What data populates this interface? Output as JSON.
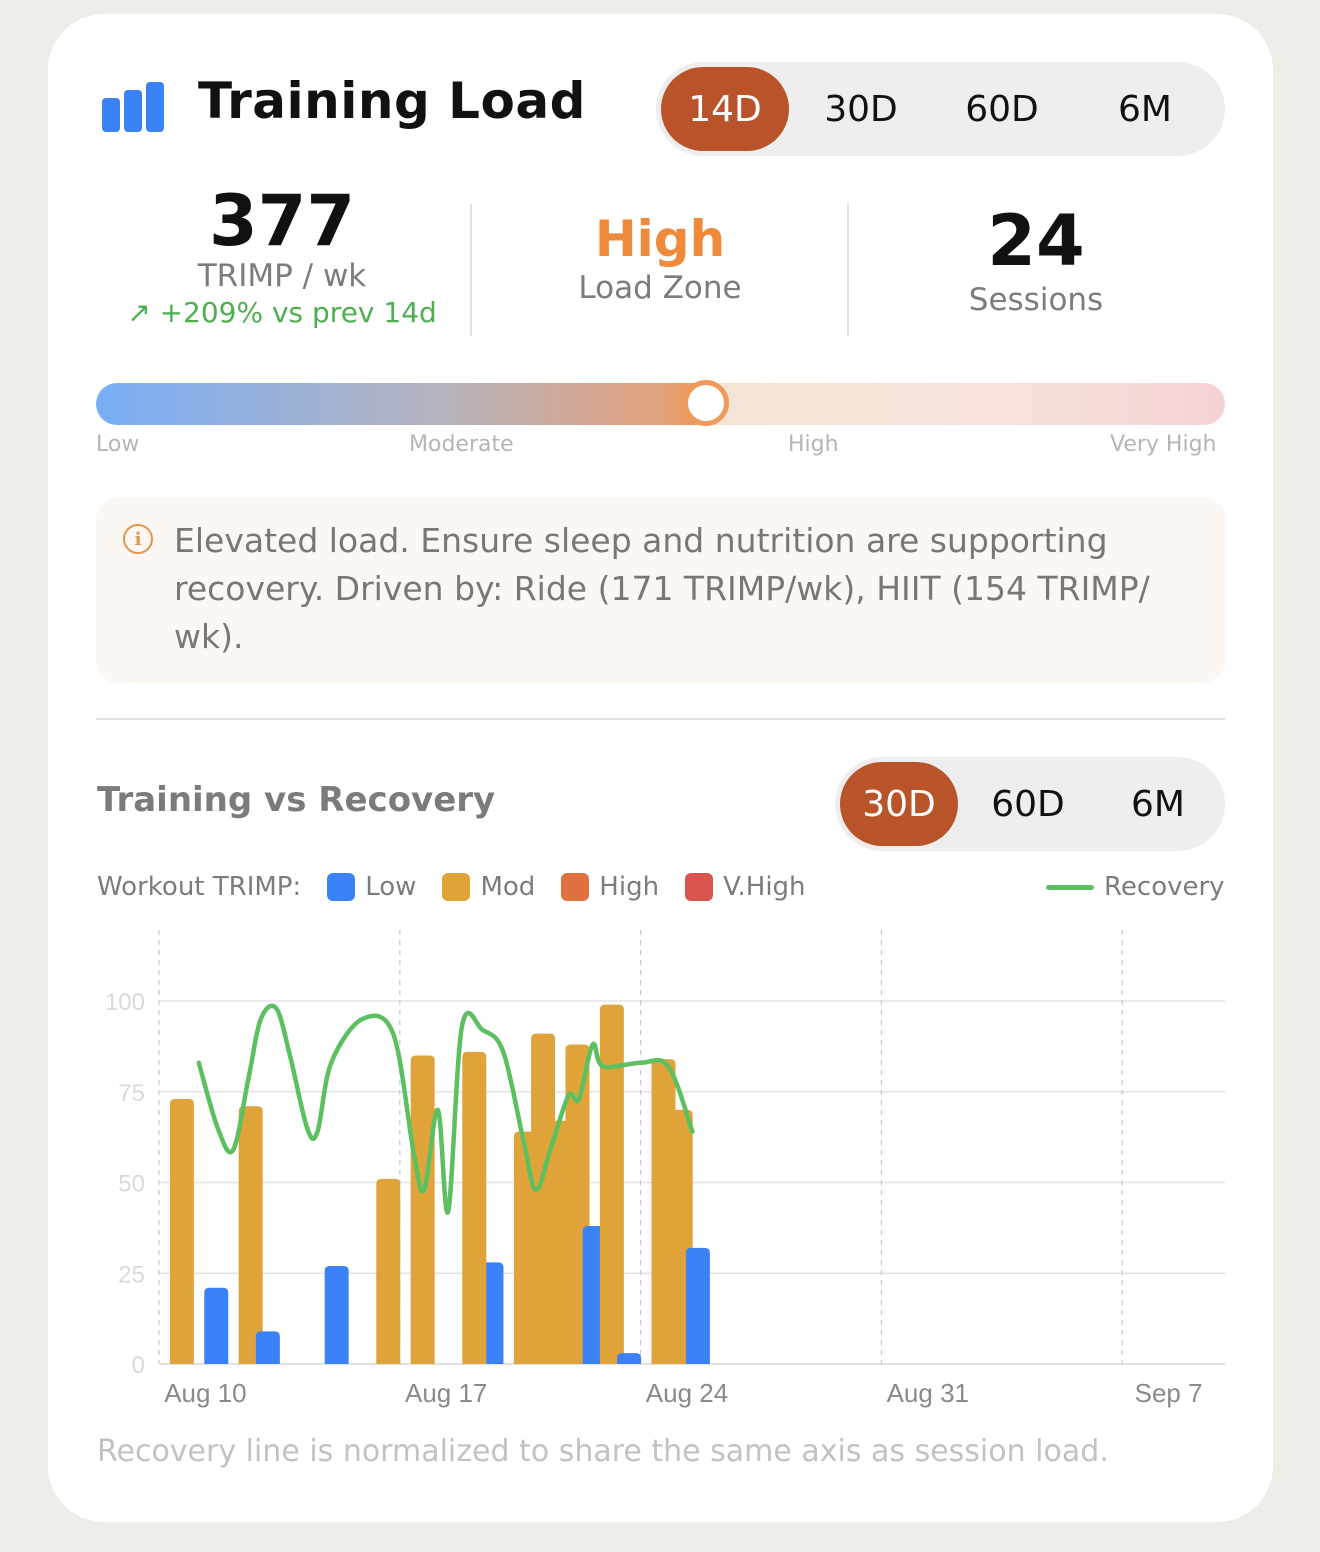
{
  "header": {
    "title": "Training Load",
    "range_options": [
      "14D",
      "30D",
      "60D",
      "6M"
    ],
    "selected_range": "14D"
  },
  "stats": {
    "trimp_value": "377",
    "trimp_label": "TRIMP / wk",
    "trimp_change_arrow": "↗",
    "trimp_change": "+209% vs prev 14d",
    "zone_value": "High",
    "zone_label": "Load Zone",
    "sessions_value": "24",
    "sessions_label": "Sessions"
  },
  "gauge": {
    "level_fraction": 0.54,
    "labels": [
      "Low",
      "Moderate",
      "High",
      "Very High"
    ]
  },
  "alert": {
    "icon": "info-icon",
    "text": "Elevated load. Ensure sleep and nutrition are supporting recovery. Driven by: Ride (171 TRIMP/wk), HIIT (154 TRIMP/ wk)."
  },
  "section": {
    "title": "Training vs Recovery",
    "range_options": [
      "30D",
      "60D",
      "6M"
    ],
    "selected_range": "30D"
  },
  "legend": {
    "prefix": "Workout TRIMP:",
    "items": [
      {
        "label": "Low",
        "color": "#3b82f6"
      },
      {
        "label": "Mod",
        "color": "#e0a33a"
      },
      {
        "label": "High",
        "color": "#e07040"
      },
      {
        "label": "V.High",
        "color": "#d9534f"
      }
    ],
    "recovery_label": "Recovery",
    "recovery_color": "#5cbf60"
  },
  "footnote": "Recovery line is normalized to share the same axis as session load.",
  "chart_data": {
    "type": "bar",
    "x_labels": [
      "Aug 10",
      "Aug 17",
      "Aug 24",
      "Aug 31",
      "Sep 7"
    ],
    "x_label_days": [
      1,
      8,
      15,
      22,
      29
    ],
    "ylim": [
      0,
      120
    ],
    "yticks": [
      0,
      25,
      50,
      75,
      100
    ],
    "grid": true,
    "bars": [
      {
        "day": 0.2,
        "value": 73,
        "zone": "Mod"
      },
      {
        "day": 1.2,
        "value": 21,
        "zone": "Low"
      },
      {
        "day": 2.2,
        "value": 71,
        "zone": "Mod"
      },
      {
        "day": 2.7,
        "value": 9,
        "zone": "Low"
      },
      {
        "day": 4.7,
        "value": 27,
        "zone": "Low"
      },
      {
        "day": 6.2,
        "value": 51,
        "zone": "Mod"
      },
      {
        "day": 7.2,
        "value": 85,
        "zone": "Mod"
      },
      {
        "day": 9.2,
        "value": 28,
        "zone": "Low"
      },
      {
        "day": 8.7,
        "value": 86,
        "zone": "Mod"
      },
      {
        "day": 10.2,
        "value": 64,
        "zone": "Mod"
      },
      {
        "day": 10.7,
        "value": 91,
        "zone": "Mod"
      },
      {
        "day": 11.2,
        "value": 67,
        "zone": "Mod"
      },
      {
        "day": 11.7,
        "value": 88,
        "zone": "Mod"
      },
      {
        "day": 12.2,
        "value": 38,
        "zone": "Low"
      },
      {
        "day": 12.7,
        "value": 99,
        "zone": "Mod"
      },
      {
        "day": 13.2,
        "value": 3,
        "zone": "Low"
      },
      {
        "day": 14.2,
        "value": 84,
        "zone": "Mod"
      },
      {
        "day": 14.7,
        "value": 70,
        "zone": "Mod"
      },
      {
        "day": 15.2,
        "value": 32,
        "zone": "Low"
      }
    ],
    "recovery": {
      "name": "Recovery",
      "points": [
        [
          0.75,
          83
        ],
        [
          1.3,
          65
        ],
        [
          1.75,
          59
        ],
        [
          2.2,
          79
        ],
        [
          2.55,
          95
        ],
        [
          3.0,
          98
        ],
        [
          3.4,
          85
        ],
        [
          3.9,
          65
        ],
        [
          4.2,
          64
        ],
        [
          4.6,
          83
        ],
        [
          5.5,
          95
        ],
        [
          6.4,
          91
        ],
        [
          7.0,
          58
        ],
        [
          7.3,
          48
        ],
        [
          7.7,
          70
        ],
        [
          8.0,
          42
        ],
        [
          8.4,
          93
        ],
        [
          9.0,
          92
        ],
        [
          9.6,
          86
        ],
        [
          10.2,
          61
        ],
        [
          10.55,
          48
        ],
        [
          11.0,
          60
        ],
        [
          11.5,
          74
        ],
        [
          11.8,
          73
        ],
        [
          12.2,
          88
        ],
        [
          12.5,
          82
        ],
        [
          13.6,
          83
        ],
        [
          14.4,
          82
        ],
        [
          15.1,
          64
        ]
      ]
    }
  }
}
